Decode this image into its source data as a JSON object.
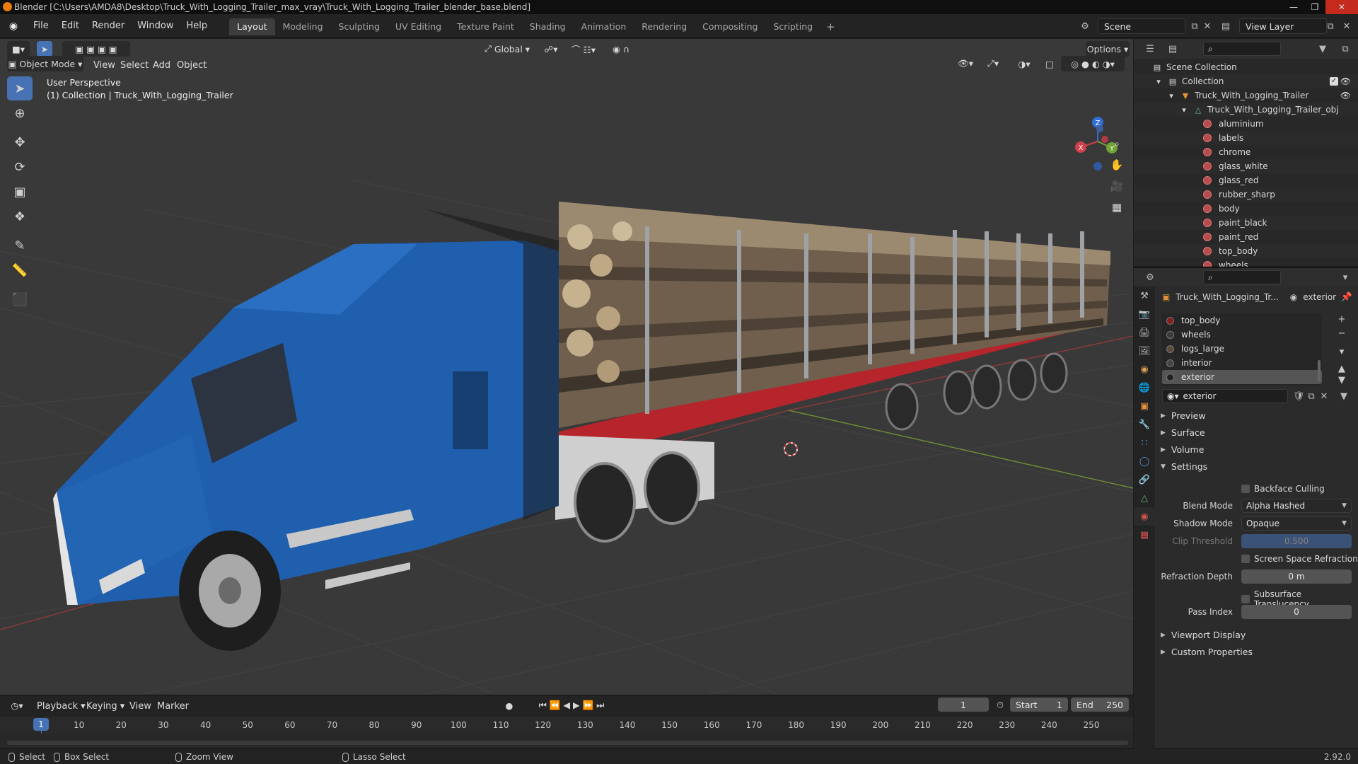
{
  "window": {
    "title": "Blender [C:\\Users\\AMDA8\\Desktop\\Truck_With_Logging_Trailer_max_vray\\Truck_With_Logging_Trailer_blender_base.blend]"
  },
  "menu": {
    "items": [
      "File",
      "Edit",
      "Render",
      "Window",
      "Help"
    ]
  },
  "workspaces": {
    "tabs": [
      "Layout",
      "Modeling",
      "Sculpting",
      "UV Editing",
      "Texture Paint",
      "Shading",
      "Animation",
      "Rendering",
      "Compositing",
      "Scripting"
    ],
    "active": "Layout"
  },
  "scene": {
    "name": "Scene",
    "view_layer": "View Layer"
  },
  "viewport": {
    "mode": "Object Mode",
    "menus": [
      "View",
      "Select",
      "Add",
      "Object"
    ],
    "transform_orientation": "Global",
    "options_label": "Options",
    "overlay_line1": "User Perspective",
    "overlay_line2": "(1) Collection | Truck_With_Logging_Trailer",
    "gizmo": {
      "x": "X",
      "y": "Y",
      "z": "Z"
    }
  },
  "outliner": {
    "scene_collection": "Scene Collection",
    "collection": "Collection",
    "object": "Truck_With_Logging_Trailer",
    "mesh": "Truck_With_Logging_Trailer_obj",
    "materials": [
      "aluminium",
      "labels",
      "chrome",
      "glass_white",
      "glass_red",
      "rubber_sharp",
      "body",
      "paint_black",
      "paint_red",
      "top_body",
      "wheels"
    ]
  },
  "properties": {
    "object_name": "Truck_With_Logging_Tr...",
    "material_name": "exterior",
    "slots": [
      {
        "name": "top_body",
        "color": "#8a1c1c"
      },
      {
        "name": "wheels",
        "color": "#3a3a3a"
      },
      {
        "name": "logs_large",
        "color": "#5a4a3a"
      },
      {
        "name": "interior",
        "color": "#444444"
      },
      {
        "name": "exterior",
        "color": "#222222"
      }
    ],
    "active_slot": "exterior",
    "material_field": "exterior",
    "sections": {
      "preview": "Preview",
      "surface": "Surface",
      "volume": "Volume",
      "settings": "Settings",
      "viewport_display": "Viewport Display",
      "custom_properties": "Custom Properties"
    },
    "settings": {
      "backface_culling": "Backface Culling",
      "blend_mode_label": "Blend Mode",
      "blend_mode": "Alpha Hashed",
      "shadow_mode_label": "Shadow Mode",
      "shadow_mode": "Opaque",
      "clip_threshold_label": "Clip Threshold",
      "clip_threshold": "0.500",
      "ssr": "Screen Space Refraction",
      "refraction_depth_label": "Refraction Depth",
      "refraction_depth": "0 m",
      "subsurface": "Subsurface Translucency",
      "pass_index_label": "Pass Index",
      "pass_index": "0"
    }
  },
  "timeline": {
    "menus": [
      "Playback",
      "Keying",
      "View",
      "Marker"
    ],
    "current_frame": "1",
    "start_label": "Start",
    "start": "1",
    "end_label": "End",
    "end": "250",
    "ruler": [
      "10",
      "20",
      "30",
      "40",
      "50",
      "60",
      "70",
      "80",
      "90",
      "100",
      "110",
      "120",
      "130",
      "140",
      "150",
      "160",
      "170",
      "180",
      "190",
      "200",
      "210",
      "220",
      "230",
      "240",
      "250"
    ],
    "ruler_current": "1"
  },
  "statusbar": {
    "select": "Select",
    "box_select": "Box Select",
    "zoom_view": "Zoom View",
    "lasso_select": "Lasso Select",
    "version": "2.92.0"
  },
  "colors": {
    "accent": "#4772b3",
    "truck_blue": "#1f5fae",
    "trailer_red": "#b5252b",
    "close_red": "#c42b1c"
  }
}
